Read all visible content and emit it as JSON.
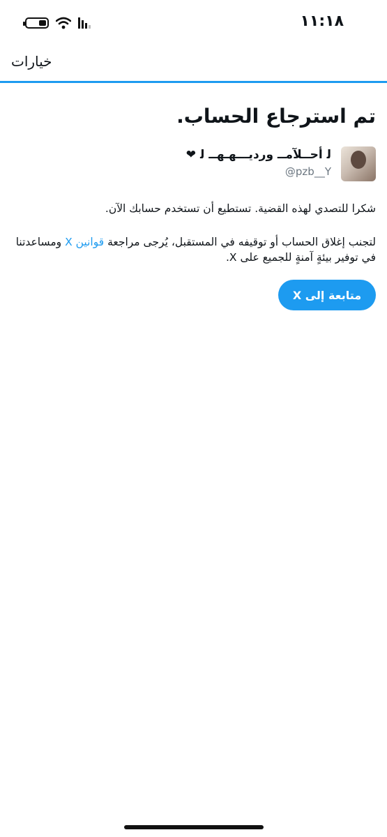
{
  "status_bar": {
    "time": "١١:١٨",
    "battery_level": 0.4,
    "icons": [
      "battery-icon",
      "wifi-icon",
      "signal-icon"
    ]
  },
  "header": {
    "title": "خيارات"
  },
  "main": {
    "title": "تم استرجاع الحساب.",
    "user": {
      "display_name": "ﻟ أحــلآمــ ورديـــهـهــ ﻟ ❤",
      "handle": "@pzb__Y"
    },
    "message_1": "شكرا للتصدي لهذه القضية. تستطيع أن تستخدم حسابك الآن.",
    "message_2_before": "لتجنب إغلاق الحساب أو توقيفه في المستقبل، يُرجى مراجعة ",
    "message_2_link": "قوانين X",
    "message_2_after": " ومساعدتنا في توفير بيئةٍ آمنةٍ للجميع على X.",
    "continue_label": "متابعة إلى X"
  },
  "colors": {
    "accent": "#1d9bf0",
    "text": "#0f1419",
    "muted": "#6b7680"
  }
}
